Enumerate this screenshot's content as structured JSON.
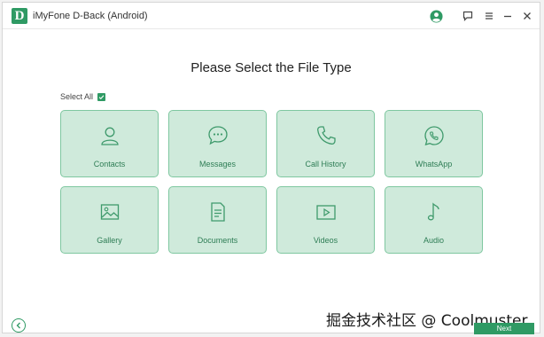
{
  "app": {
    "logo_letter": "D",
    "title": "iMyFone D-Back (Android)"
  },
  "titlebar_icons": {
    "account": "account-icon",
    "feedback": "feedback-icon",
    "menu": "menu-icon",
    "minimize": "minimize-icon",
    "close": "close-icon"
  },
  "main": {
    "heading": "Please Select the File Type",
    "select_all_label": "Select All",
    "select_all_checked": true,
    "file_types": [
      {
        "label": "Contacts",
        "icon": "contacts-icon"
      },
      {
        "label": "Messages",
        "icon": "messages-icon"
      },
      {
        "label": "Call History",
        "icon": "phone-icon"
      },
      {
        "label": "WhatsApp",
        "icon": "whatsapp-icon"
      },
      {
        "label": "Gallery",
        "icon": "gallery-icon"
      },
      {
        "label": "Documents",
        "icon": "document-icon"
      },
      {
        "label": "Videos",
        "icon": "video-icon"
      },
      {
        "label": "Audio",
        "icon": "music-note-icon"
      }
    ]
  },
  "footer": {
    "next_label": "Next",
    "watermark": "掘金技术社区 @ Coolmuster"
  },
  "colors": {
    "accent": "#2f9a64",
    "tile_fill": "#cfeadb",
    "tile_border": "#7fc7a0",
    "tile_text": "#2e7d55"
  }
}
